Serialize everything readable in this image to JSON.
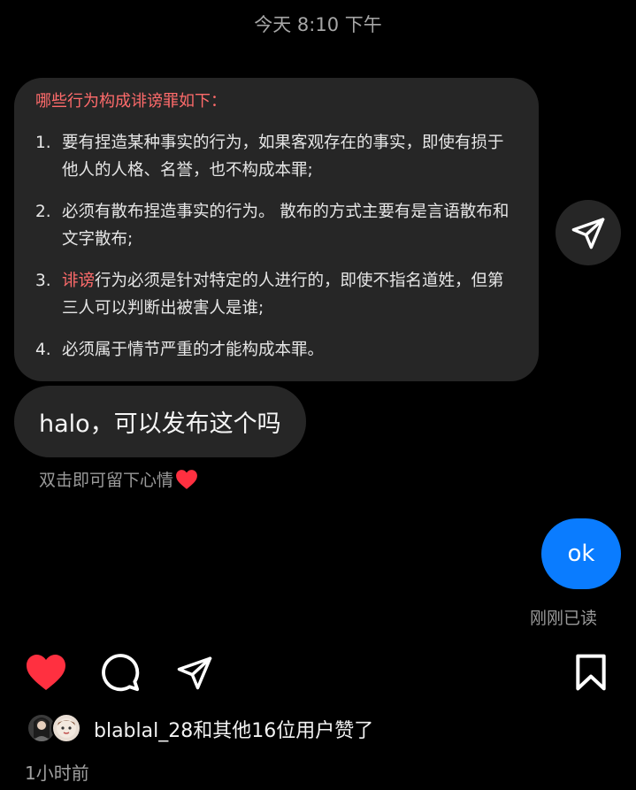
{
  "header": {
    "timestamp": "今天 8:10 下午"
  },
  "shared_card": {
    "title": "哪些行为构成诽谤罪如下：",
    "items": [
      {
        "num": "1.",
        "text": "要有捏造某种事实的行为，如果客观存在的事实，即使有损于他人的人格、名誉，也不构成本罪;"
      },
      {
        "num": "2.",
        "text": "必须有散布捏造事实的行为。 散布的方式主要有是言语散布和文字散布;"
      },
      {
        "num": "3.",
        "highlight": "诽谤",
        "text": "行为必须是针对特定的人进行的，即使不指名道姓，但第三人可以判断出被害人是谁;"
      },
      {
        "num": "4.",
        "text": "必须属于情节严重的才能构成本罪。"
      }
    ]
  },
  "messages": {
    "received": "halo，可以发布这个吗",
    "reaction_hint": "双击即可留下心情",
    "sent": "ok",
    "read_status": "刚刚已读"
  },
  "post": {
    "likes_text": "blablal_28和其他16位用户赞了",
    "time_ago": "1小时前"
  },
  "colors": {
    "background": "#000000",
    "bubble": "#262626",
    "accent_red": "#ff6b6b",
    "heart_red": "#ff3040",
    "sent_blue": "#0a7cff"
  },
  "icons": {
    "share": "paper-plane-icon",
    "like": "heart-icon",
    "comment": "comment-bubble-icon",
    "send": "paper-plane-icon",
    "save": "bookmark-icon",
    "reaction": "red-heart-emoji"
  }
}
